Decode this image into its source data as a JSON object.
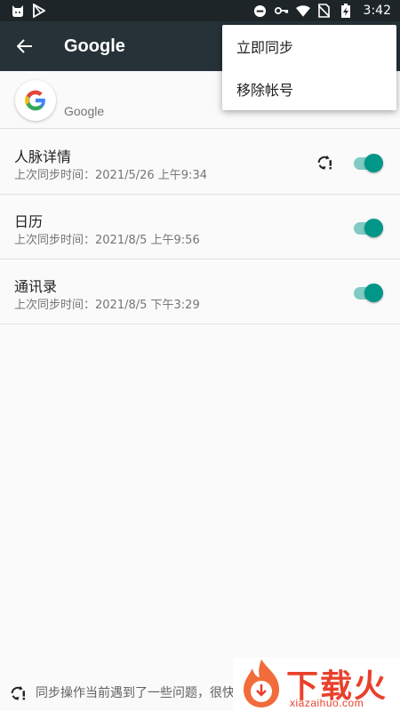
{
  "status_bar": {
    "time": "3:42",
    "icons_left": [
      "cat-icon",
      "play-store-icon"
    ],
    "icons_right": [
      "do-not-disturb-icon",
      "key-icon",
      "wifi-icon",
      "no-sim-icon",
      "battery-charging-icon"
    ]
  },
  "app_bar": {
    "title": "Google"
  },
  "account": {
    "label": "Google"
  },
  "menu": {
    "items": [
      {
        "label": "立即同步"
      },
      {
        "label": "移除帐号"
      }
    ]
  },
  "sync_items": [
    {
      "title": "人脉详情",
      "subtitle": "上次同步时间：2021/5/26 上午9:34",
      "enabled": true,
      "error": true
    },
    {
      "title": "日历",
      "subtitle": "上次同步时间：2021/8/5 上午9:56",
      "enabled": true,
      "error": false
    },
    {
      "title": "通讯录",
      "subtitle": "上次同步时间：2021/8/5 下午3:29",
      "enabled": true,
      "error": false
    }
  ],
  "bottom": {
    "message": "同步操作当前遇到了一些问题，很快"
  },
  "watermark": {
    "text": "下载火",
    "url": "xiazaihuo.com"
  },
  "colors": {
    "app_bar": "#263238",
    "status_bar": "#1e2528",
    "accent": "#009688",
    "track": "#80cbc4",
    "watermark": "#e8412c"
  }
}
